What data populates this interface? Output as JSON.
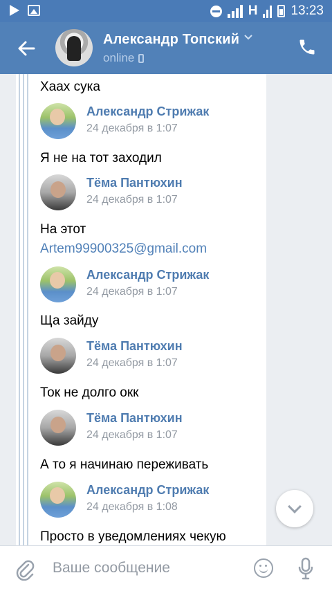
{
  "statusbar": {
    "network": "H",
    "time": "13:23"
  },
  "header": {
    "title": "Александр Топский",
    "status": "online"
  },
  "messages": [
    {
      "type": "text",
      "text": "Хаах сука"
    },
    {
      "type": "sender",
      "name": "Александр Стрижак",
      "time": "24 декабря в 1:07",
      "avatar": "strizhak"
    },
    {
      "type": "text",
      "text": "Я не на тот заходил"
    },
    {
      "type": "sender",
      "name": "Тёма Пантюхин",
      "time": "24 декабря в 1:07",
      "avatar": "tema"
    },
    {
      "type": "text",
      "text": "На этот"
    },
    {
      "type": "link",
      "text": "Artem99900325@gmail.com"
    },
    {
      "type": "sender",
      "name": "Александр Стрижак",
      "time": "24 декабря в 1:07",
      "avatar": "strizhak"
    },
    {
      "type": "text",
      "text": "Ща зайду"
    },
    {
      "type": "sender",
      "name": "Тёма Пантюхин",
      "time": "24 декабря в 1:07",
      "avatar": "tema"
    },
    {
      "type": "text",
      "text": "Ток не долго окк"
    },
    {
      "type": "sender",
      "name": "Тёма Пантюхин",
      "time": "24 декабря в 1:07",
      "avatar": "tema"
    },
    {
      "type": "text",
      "text": "А то я начинаю переживать"
    },
    {
      "type": "sender",
      "name": "Александр Стрижак",
      "time": "24 декабря в 1:08",
      "avatar": "strizhak"
    },
    {
      "type": "text",
      "text": "Просто в уведомлениях чекую"
    }
  ],
  "composer": {
    "placeholder": "Ваше сообщение"
  },
  "colors": {
    "header_bg": "#5181b8",
    "statusbar_bg": "#4a7bb7",
    "name_color": "#4f7cb0",
    "link_color": "#5181b8"
  }
}
